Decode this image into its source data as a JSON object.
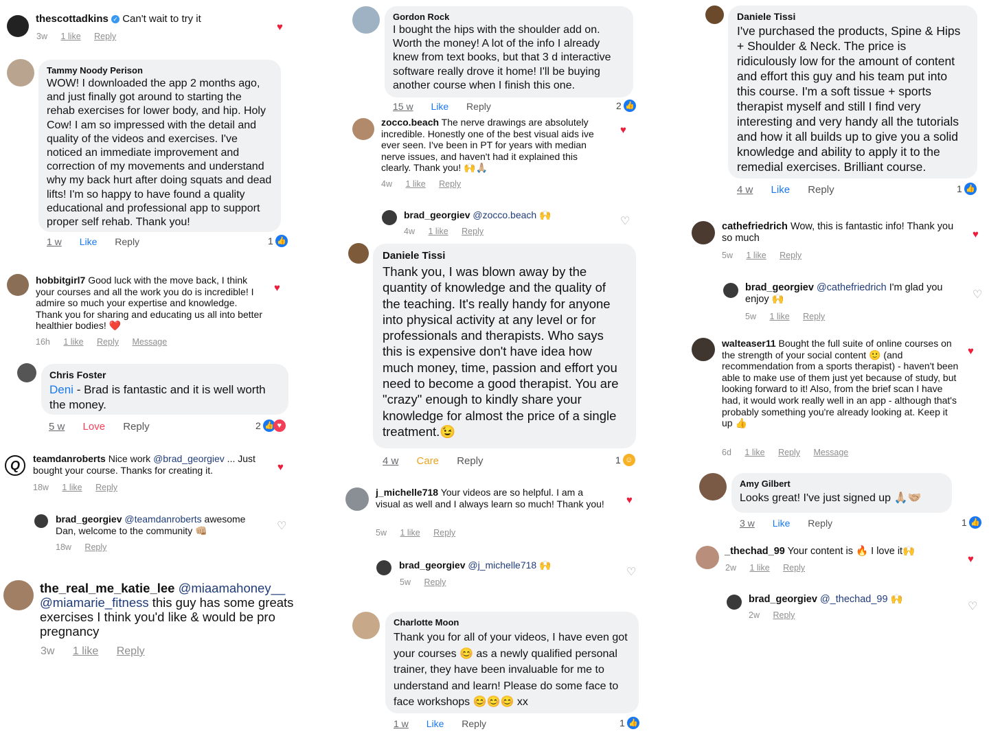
{
  "c1": {
    "user": "thescottadkins",
    "text": "Can't wait to try it",
    "meta": [
      "3w",
      "1 like",
      "Reply"
    ]
  },
  "c2": {
    "name": "Tammy Noody Perison",
    "text": "WOW! I downloaded the app 2 months ago, and just finally got around to starting the rehab exercises for lower body, and hip. Holy Cow! I am so impressed with the detail and quality of the videos and exercises.  I've noticed an immediate improvement and correction of my movements and understand why my back hurt after doing squats and dead lifts! I'm so happy to have found a quality educational and professional app to support proper self rehab. Thank you!",
    "meta": [
      "1 w",
      "Like",
      "Reply"
    ],
    "count": "1"
  },
  "c3": {
    "user": "hobbitgirl7",
    "text": "Good luck with the move back, I think your courses and all the work you do is incredible! I admire so much your expertise and knowledge. Thank you for sharing and educating us all into better healthier bodies! ❤️",
    "meta": [
      "16h",
      "1 like",
      "Reply",
      "Message"
    ]
  },
  "c4": {
    "name": "Chris Foster",
    "mention": "Deni",
    "text": " - Brad is fantastic and it is well worth the money.",
    "meta": [
      "5 w",
      "Love",
      "Reply"
    ],
    "count": "2"
  },
  "c5": {
    "user": "teamdanroberts",
    "pre": "Nice work ",
    "mention": "@brad_georgiev",
    "text": " ... Just bought your course. Thanks for creating it.",
    "meta": [
      "18w",
      "1 like",
      "Reply"
    ]
  },
  "c6": {
    "user": "brad_georgiev",
    "mention": "@teamdanroberts",
    "text": " awesome Dan, welcome to the community 👊🏼",
    "meta": [
      "18w",
      "Reply"
    ]
  },
  "c7": {
    "user": "the_real_me_katie_lee",
    "mention": "@miaamahoney__ @miamarie_fitness",
    "text": " this guy has some greats exercises I think you'd like & would be pro pregnancy",
    "meta": [
      "3w",
      "1 like",
      "Reply"
    ]
  },
  "c8": {
    "name": "Gordon Rock",
    "text": "I bought the hips with the shoulder add on. Worth the money!  A lot of the info I already knew from text books, but that 3 d interactive software really drove it home!   I'll be buying another course when I finish this one.",
    "meta": [
      "15 w",
      "Like",
      "Reply"
    ],
    "count": "2"
  },
  "c9": {
    "user": "zocco.beach",
    "text": "The nerve drawings are absolutely incredible. Honestly one of the best visual aids ive ever seen. I've been in PT for years with median nerve issues, and haven't had it explained this clearly. Thank you! 🙌🙏🏼",
    "meta": [
      "4w",
      "1 like",
      "Reply"
    ]
  },
  "c10": {
    "user": "brad_georgiev",
    "mention": "@zocco.beach",
    "text": " 🙌",
    "meta": [
      "4w",
      "1 like",
      "Reply"
    ]
  },
  "c11": {
    "name": "Daniele Tissi",
    "text": "Thank you, I was blown away by the quantity of knowledge and the quality of the teaching. It's really handy for anyone into physical activity at any level or for professionals and therapists. Who says this is expensive don't have idea how much money, time, passion and effort you need to become a good therapist. You are \"crazy\" enough to kindly share your knowledge for almost the price of a single treatment.😉",
    "meta": [
      "4 w",
      "Care",
      "Reply"
    ],
    "count": "1"
  },
  "c12": {
    "user": "j_michelle718",
    "text": "Your videos are so helpful. I am a visual as well and I always learn so much! Thank you!",
    "meta": [
      "5w",
      "1 like",
      "Reply"
    ]
  },
  "c13": {
    "user": "brad_georgiev",
    "mention": "@j_michelle718",
    "text": " 🙌",
    "meta": [
      "5w",
      "Reply"
    ]
  },
  "c14": {
    "name": "Charlotte Moon",
    "text": "Thank you for all of your videos, I have even got your courses 😊 as a newly qualified personal trainer, they have been invaluable for me to understand and learn! Please do some face to face workshops 😊😊😊 xx",
    "meta": [
      "1 w",
      "Like",
      "Reply"
    ],
    "count": "1"
  },
  "c15": {
    "name": "Daniele Tissi",
    "text": "I've purchased the products, Spine & Hips + Shoulder & Neck. The price is ridiculously low for the amount of content and effort this guy and his team put into this course. I'm a soft tissue + sports therapist myself and still I find very interesting and very handy all the tutorials and how it all builds up to give you a solid knowledge and ability to apply it to the remedial exercises. Brilliant course.",
    "meta": [
      "4 w",
      "Like",
      "Reply"
    ],
    "count": "1"
  },
  "c16": {
    "user": "cathefriedrich",
    "text": "Wow, this is fantastic info!  Thank you so much",
    "meta": [
      "5w",
      "1 like",
      "Reply"
    ]
  },
  "c17": {
    "user": "brad_georgiev",
    "mention": "@cathefriedrich",
    "text": " I'm glad you enjoy 🙌",
    "meta": [
      "5w",
      "1 like",
      "Reply"
    ]
  },
  "c18": {
    "user": "walteaser11",
    "text": "Bought the full suite of online courses on the strength of your social content 🙂 (and recommendation from a sports therapist) - haven't been able to make use of them just yet because of study, but looking forward to it! Also, from the brief scan I have had, it would work really well in an app - although that's probably something you're already looking at. Keep it up 👍",
    "meta": [
      "6d",
      "1 like",
      "Reply",
      "Message"
    ]
  },
  "c19": {
    "name": "Amy Gilbert",
    "text": "Looks great! I've just signed up 🙏🏼🤝🏼",
    "meta": [
      "3 w",
      "Like",
      "Reply"
    ],
    "count": "1"
  },
  "c20": {
    "user": "_thechad_99",
    "text": "Your content is 🔥 I love it🙌",
    "meta": [
      "2w",
      "1 like",
      "Reply"
    ]
  },
  "c21": {
    "user": "brad_georgiev",
    "mention": "@_thechad_99",
    "text": " 🙌",
    "meta": [
      "2w",
      "Reply"
    ]
  },
  "colors": {
    "heart": "#ed1e3b",
    "fb_blue": "#1877f2",
    "bubble": "#f0f1f3"
  }
}
